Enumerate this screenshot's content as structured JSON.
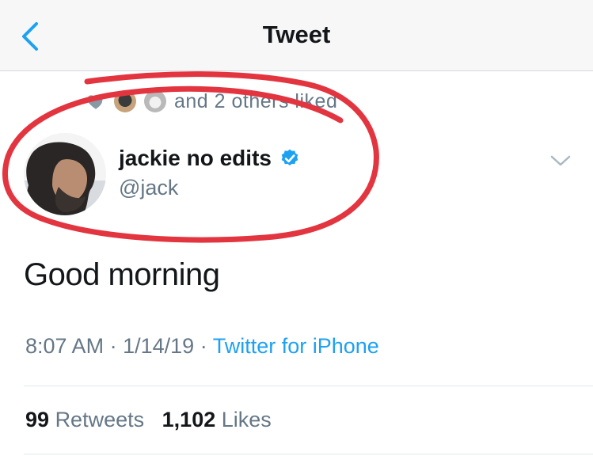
{
  "nav": {
    "title": "Tweet",
    "back_icon": "chevron-left-icon"
  },
  "social_context": {
    "heart_icon": "heart-icon",
    "text": "and 2 others liked"
  },
  "author": {
    "name": "jackie no edits",
    "handle": "@jack",
    "verified": true,
    "menu_icon": "chevron-down-icon"
  },
  "tweet": {
    "text": "Good morning",
    "time": "8:07 AM",
    "date": "1/14/19",
    "source": "Twitter for iPhone"
  },
  "stats": {
    "retweets_count": "99",
    "retweets_label": "Retweets",
    "likes_count": "1,102",
    "likes_label": "Likes"
  },
  "colors": {
    "accent": "#1da1f2",
    "annotation": "#e2353f",
    "muted_text": "#657786"
  }
}
